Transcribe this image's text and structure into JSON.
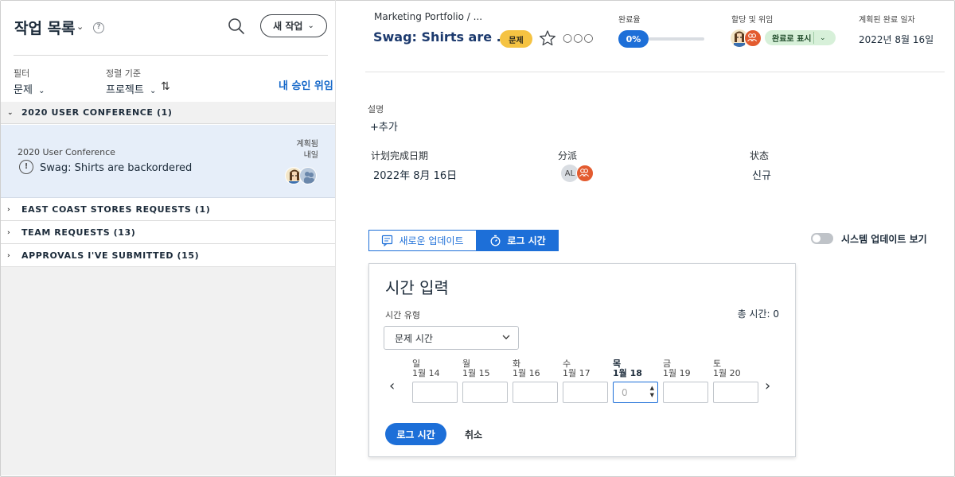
{
  "left_panel": {
    "title": "작업 목록",
    "new_task_label": "새 작업",
    "filter_label": "필터",
    "filter_value": "문제",
    "sort_label": "정렬 기준",
    "sort_value": "프로젝트",
    "approvals_link": "내 승인 위임",
    "groups": [
      {
        "label": "2020 USER CONFERENCE (1)",
        "expanded": true
      },
      {
        "label": "EAST COAST STORES  REQUESTS (1)",
        "expanded": false
      },
      {
        "label": "TEAM REQUESTS (13)",
        "expanded": false
      },
      {
        "label": "APPROVALS I'VE SUBMITTED (15)",
        "expanded": false
      }
    ],
    "task_card": {
      "project": "2020 User Conference",
      "name": "Swag: Shirts are backordered",
      "planned_line1": "계획됨",
      "planned_line2": "내일"
    }
  },
  "header": {
    "breadcrumb": "Marketing Portfolio  /  ...",
    "task_title": "Swag: Shirts are ...",
    "type_badge": "문제",
    "completion_label": "완료율",
    "completion_value": "0%",
    "completion_fraction": 0,
    "assign_label": "할당 및 위임",
    "status_button": "완료로 표시",
    "due_label": "계획된 완료 일자",
    "due_value": "2022년 8월 16일"
  },
  "details": {
    "description_label": "설명",
    "add_label": "+추가",
    "planned_label": "计划完成日期",
    "planned_value": "2022年 8月 16日",
    "assign_label": "分派",
    "assignee_initials": "AL",
    "status_label": "状态",
    "status_value": "신규"
  },
  "tabs": {
    "updates_label": "새로운 업데이트",
    "log_label": "로그 시간"
  },
  "system_toggle": {
    "label": "시스템 업데이트 보기",
    "on": false
  },
  "time_entry": {
    "title": "시간 입력",
    "type_label": "시간 유형",
    "total_label": "총 시간: 0",
    "type_value": "문제 시간",
    "days": [
      {
        "name": "일",
        "date": "1월 14",
        "value": "",
        "today": false
      },
      {
        "name": "월",
        "date": "1월 15",
        "value": "",
        "today": false
      },
      {
        "name": "화",
        "date": "1월 16",
        "value": "",
        "today": false
      },
      {
        "name": "수",
        "date": "1월 17",
        "value": "",
        "today": false
      },
      {
        "name": "목",
        "date": "1월 18",
        "value": "0",
        "today": true
      },
      {
        "name": "금",
        "date": "1월 19",
        "value": "",
        "today": false
      },
      {
        "name": "토",
        "date": "1월 20",
        "value": "",
        "today": false
      }
    ],
    "log_button": "로그 시간",
    "cancel_button": "취소"
  },
  "colors": {
    "accent": "#1d6fd8",
    "badge_yellow": "#f5c342",
    "status_green": "#d7f0d9",
    "selected_row": "#e6eef9"
  }
}
